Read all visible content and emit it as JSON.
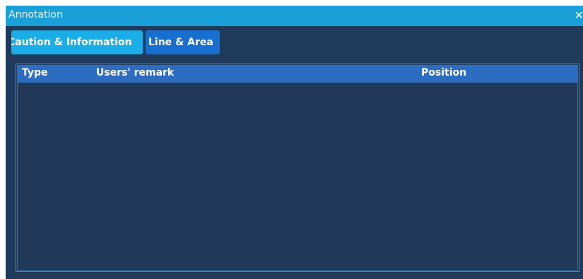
{
  "window": {
    "title": "Annotation",
    "close_label": "×"
  },
  "tabs": [
    {
      "label": "Caution & Information",
      "active": true
    },
    {
      "label": "Line & Area",
      "active": false
    }
  ],
  "table": {
    "columns": [
      "Type",
      "Users' remark",
      "Position"
    ],
    "rows": []
  },
  "colors": {
    "titlebar": "#1aa0d8",
    "window_background": "#1f3a5a",
    "active_tab": "#19aee8",
    "inactive_tab": "#176fd0",
    "table_header": "#2d6dc1",
    "table_border": "#2f8fd3"
  }
}
